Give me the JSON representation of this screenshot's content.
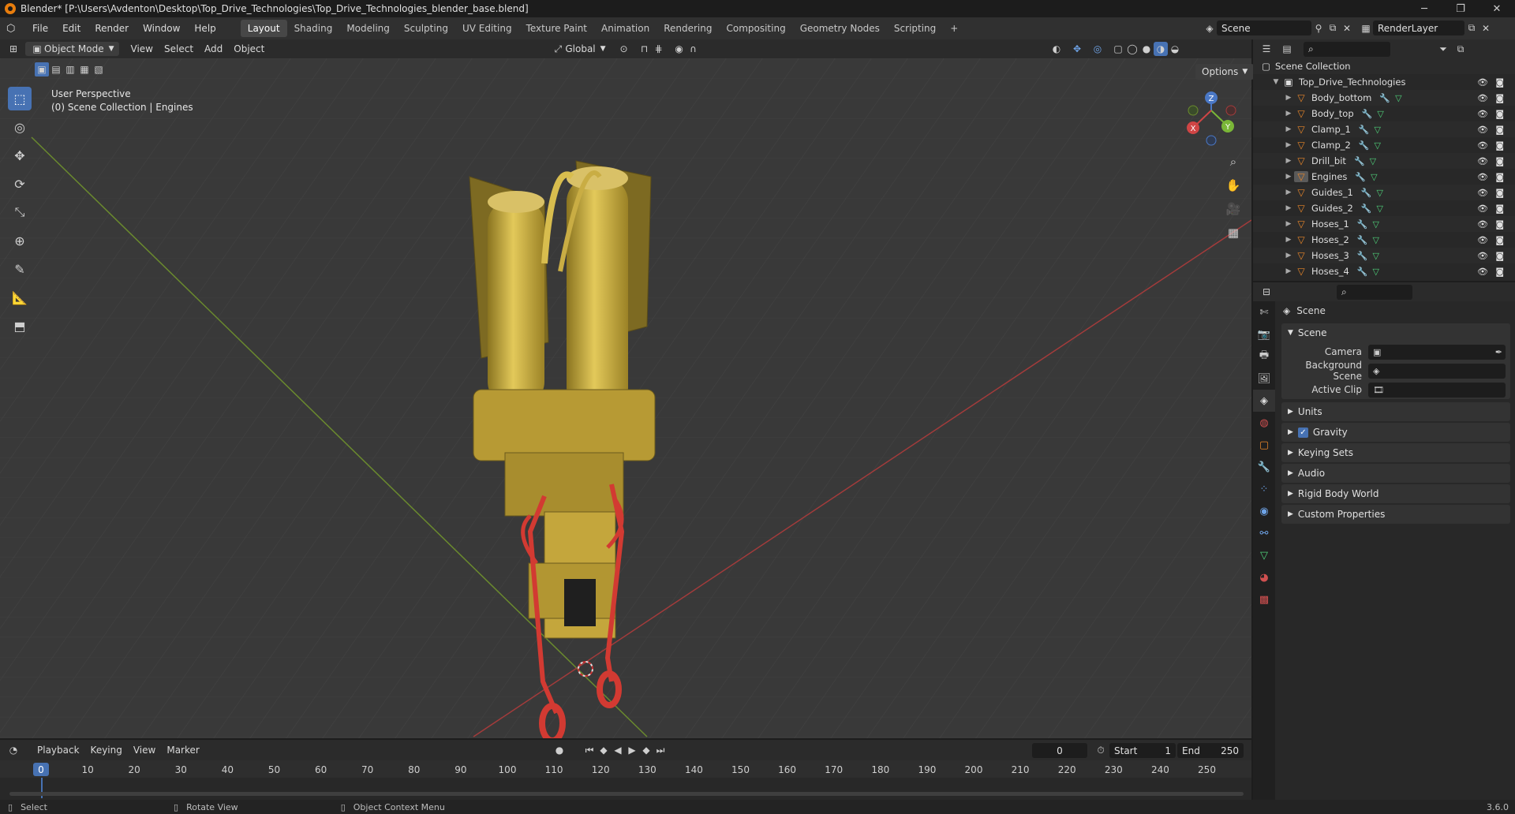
{
  "window": {
    "title": "Blender* [P:\\Users\\Avdenton\\Desktop\\Top_Drive_Technologies\\Top_Drive_Technologies_blender_base.blend]",
    "minimize": "─",
    "maximize": "❐",
    "close": "✕"
  },
  "menubar": {
    "menus": [
      "File",
      "Edit",
      "Render",
      "Window",
      "Help"
    ],
    "workspaces": [
      "Layout",
      "Shading",
      "Modeling",
      "Sculpting",
      "UV Editing",
      "Texture Paint",
      "Animation",
      "Rendering",
      "Compositing",
      "Geometry Nodes",
      "Scripting"
    ],
    "active_workspace": "Layout",
    "add_workspace": "+",
    "scene_name": "Scene",
    "render_layer": "RenderLayer"
  },
  "viewport_header": {
    "mode": "Object Mode",
    "menus": [
      "View",
      "Select",
      "Add",
      "Object"
    ],
    "transform_orientation": "Global",
    "options": "Options"
  },
  "viewport": {
    "perspective": "User Perspective",
    "collection_info": "(0) Scene Collection | Engines",
    "gizmo": {
      "z": "Z",
      "y": "Y",
      "x": "X"
    }
  },
  "outliner": {
    "root": "Scene Collection",
    "collection": "Top_Drive_Technologies",
    "objects": [
      "Body_bottom",
      "Body_top",
      "Clamp_1",
      "Clamp_2",
      "Drill_bit",
      "Engines",
      "Guides_1",
      "Guides_2",
      "Hoses_1",
      "Hoses_2",
      "Hoses_3",
      "Hoses_4"
    ],
    "active_object": "Engines"
  },
  "properties": {
    "context": "Scene",
    "scene_panel": "Scene",
    "fields": [
      {
        "label": "Camera",
        "value": ""
      },
      {
        "label": "Background Scene",
        "value": ""
      },
      {
        "label": "Active Clip",
        "value": ""
      }
    ],
    "collapsed_panels": [
      "Units",
      "Gravity",
      "Keying Sets",
      "Audio",
      "Rigid Body World",
      "Custom Properties"
    ],
    "gravity_checked": true
  },
  "timeline": {
    "menus": [
      "Playback",
      "Keying",
      "View",
      "Marker"
    ],
    "current_frame": "0",
    "start_label": "Start",
    "start": "1",
    "end_label": "End",
    "end": "250",
    "ticks": [
      "0",
      "10",
      "20",
      "30",
      "40",
      "50",
      "60",
      "70",
      "80",
      "90",
      "100",
      "110",
      "120",
      "130",
      "140",
      "150",
      "160",
      "170",
      "180",
      "190",
      "200",
      "210",
      "220",
      "230",
      "240",
      "250"
    ]
  },
  "statusbar": {
    "select": "Select",
    "rotate": "Rotate View",
    "context_menu": "Object Context Menu",
    "version": "3.6.0"
  }
}
